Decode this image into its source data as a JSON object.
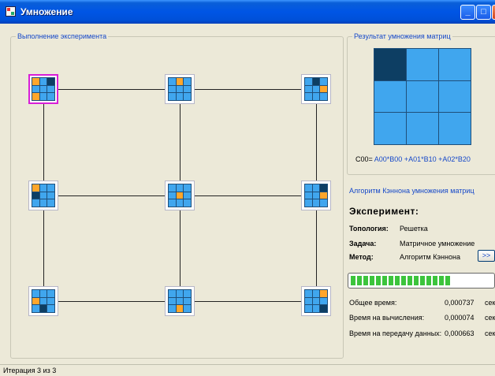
{
  "window": {
    "title": "Умножение",
    "min": "_",
    "max": "□",
    "close": "✕"
  },
  "experiment_group": {
    "caption": "Выполнение эксперимента"
  },
  "nodes": [
    [
      "o",
      "b",
      "d",
      "b",
      "b",
      "b",
      "o",
      "b",
      "b"
    ],
    [
      "b",
      "o",
      "b",
      "b",
      "b",
      "b",
      "b",
      "b",
      "b"
    ],
    [
      "b",
      "d",
      "b",
      "b",
      "b",
      "o",
      "b",
      "b",
      "b"
    ],
    [
      "o",
      "b",
      "b",
      "d",
      "b",
      "b",
      "b",
      "b",
      "b"
    ],
    [
      "b",
      "b",
      "b",
      "b",
      "o",
      "b",
      "b",
      "b",
      "b"
    ],
    [
      "b",
      "b",
      "d",
      "b",
      "b",
      "o",
      "b",
      "b",
      "b"
    ],
    [
      "b",
      "b",
      "b",
      "o",
      "b",
      "b",
      "b",
      "d",
      "b"
    ],
    [
      "b",
      "b",
      "b",
      "b",
      "b",
      "b",
      "b",
      "o",
      "b"
    ],
    [
      "b",
      "b",
      "o",
      "b",
      "b",
      "b",
      "b",
      "b",
      "d"
    ]
  ],
  "active_node": 0,
  "result_group": {
    "caption": "Результат умножения матриц"
  },
  "result_matrix": [
    "d",
    "b",
    "b",
    "b",
    "b",
    "b",
    "b",
    "b",
    "b"
  ],
  "formula": {
    "lhs": "C00= ",
    "rhs": "A00*B00  +A01*B10  +A02*B20"
  },
  "algorithm_link": "Алгоритм Кэннона умножения матриц",
  "experiment": {
    "title": "Эксперимент:",
    "topology_label": "Топология:",
    "topology_value": "Решетка",
    "task_label": "Задача:",
    "task_value": "Матричное умножение",
    "method_label": "Метод:",
    "method_value": "Алгоритм Кэннона",
    "next_button": ">>"
  },
  "progress": {
    "fraction": 0.71
  },
  "stats": {
    "total_label": "Общее время:",
    "total_value": "0,000737",
    "compute_label": "Время на вычисления:",
    "compute_value": "0,000074",
    "transfer_label": "Время на передачу данных:",
    "transfer_value": "0,000663",
    "unit": "сек"
  },
  "status": "Итерация 3 из 3",
  "colors": {
    "cell": "#40a6ee",
    "highlight": "#ffa62b",
    "dark": "#0d3e63",
    "active_border": "#d81ed8"
  }
}
